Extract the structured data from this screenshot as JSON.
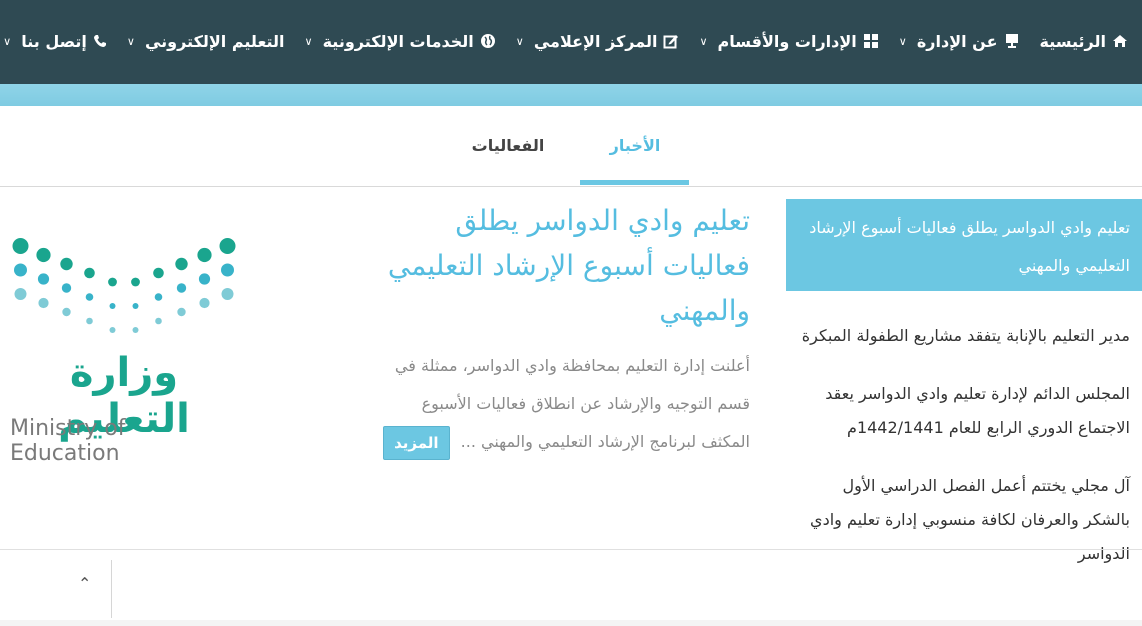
{
  "nav": {
    "items": [
      {
        "label": "الرئيسية",
        "icon": "home-icon",
        "has_dropdown": false
      },
      {
        "label": "عن الإدارة",
        "icon": "presentation-icon",
        "has_dropdown": true
      },
      {
        "label": "الإدارات والأقسام",
        "icon": "grid-icon",
        "has_dropdown": true
      },
      {
        "label": "المركز الإعلامي",
        "icon": "edit-icon",
        "has_dropdown": true
      },
      {
        "label": "الخدمات الإلكترونية",
        "icon": "globe-icon",
        "has_dropdown": true
      },
      {
        "label": "التعليم الإلكتروني",
        "icon": "",
        "has_dropdown": true
      },
      {
        "label": "إتصل بنا",
        "icon": "phone-icon",
        "has_dropdown": true
      }
    ]
  },
  "tabs": [
    {
      "label": "الأخبار",
      "active": true
    },
    {
      "label": "الفعاليات",
      "active": false
    }
  ],
  "news_list": {
    "active": "تعليم وادي الدواسر يطلق فعاليات أسبوع الإرشاد التعليمي والمهني",
    "items": [
      "مدير التعليم بالإنابة يتفقد مشاريع الطفولة المبكرة",
      "المجلس الدائم لإدارة تعليم وادي الدواسر يعقد الاجتماع الدوري الرابع للعام 1442/1441م",
      "آل مجلي يختتم أعمل الفصل الدراسي الأول بالشكر والعرفان لكافة منسوبي إدارة تعليم وادي الدواسر"
    ]
  },
  "article": {
    "title": "تعليم وادي الدواسر يطلق فعاليات أسبوع الإرشاد التعليمي والمهني",
    "body": "أعلنت إدارة التعليم بمحافظة وادي الدواسر، ممثلة في قسم التوجيه والإرشاد عن انطلاق فعاليات الأسبوع المكثف لبرنامج الإرشاد التعليمي والمهني ...",
    "more_label": "المزيد"
  },
  "logo": {
    "arabic": "وزارة التعليم",
    "english": "Ministry of Education",
    "colors": [
      "#1aa58e",
      "#38b3c9",
      "#7fcbd6"
    ]
  },
  "footer": {
    "scroll_up_icon": "chevron-up-icon",
    "scroll_up_glyph": "⌃"
  },
  "colors": {
    "nav_bg": "#2f4a53",
    "accent": "#6cc7e2",
    "title": "#55bde0"
  }
}
